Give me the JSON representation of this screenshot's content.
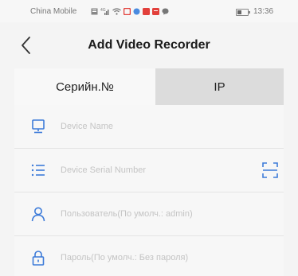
{
  "status_bar": {
    "carrier": "China Mobile",
    "time": "13:36",
    "battery_level": 0.45,
    "icons": [
      "sim-icon",
      "signal-icon",
      "wifi-icon",
      "app-notification-icon",
      "app-notification-icon",
      "app-notification-icon",
      "app-notification-icon",
      "chat-icon"
    ]
  },
  "header": {
    "title": "Add Video Recorder",
    "back_icon": "chevron-left-icon"
  },
  "tabs": [
    {
      "label": "Серийн.№",
      "active": true
    },
    {
      "label": "IP",
      "active": false
    }
  ],
  "form": {
    "device_name": {
      "placeholder": "Device Name",
      "value": "",
      "icon": "monitor-icon"
    },
    "serial_number": {
      "placeholder": "Device Serial Number",
      "value": "",
      "icon": "list-icon",
      "scan_icon": "qr-scan-icon"
    },
    "username": {
      "placeholder": "Пользователь(По умолч.: admin)",
      "value": "",
      "icon": "user-icon"
    },
    "password": {
      "placeholder": "Пароль(По умолч.: Без пароля)",
      "value": "",
      "icon": "lock-icon"
    }
  },
  "colors": {
    "accent": "#3d7bd9",
    "text_primary": "#1a1a1a",
    "placeholder": "#c4c4c4"
  }
}
